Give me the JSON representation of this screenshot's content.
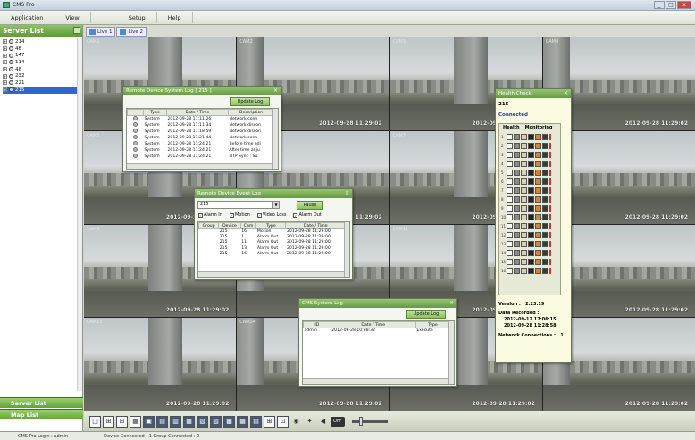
{
  "window": {
    "title": "CMS Pro",
    "min": "_",
    "max": "□",
    "close": "x"
  },
  "menu": [
    "Application",
    "View",
    "Setup",
    "Help"
  ],
  "server_list": {
    "title": "Server List",
    "items": [
      "214",
      "48",
      "147",
      "114",
      "48",
      "232",
      "221",
      "215"
    ],
    "selected_index": 7
  },
  "left_tabs": {
    "server_list": "Server List",
    "map_list": "Map List"
  },
  "view_tabs": [
    "Live 1",
    "Live 2"
  ],
  "camera_grid": {
    "timestamp": "2012-09-28 11:29:02",
    "cam_prefix": "CAM",
    "cells": 16
  },
  "system_log": {
    "title": "Remote Device System Log  [ 215 ]",
    "update_button": "Update Log",
    "columns": [
      "Type",
      "Date / Time",
      "Description"
    ],
    "rows": [
      [
        "System",
        "2012-09-28 11:11:26",
        "Network conn"
      ],
      [
        "System",
        "2012-09-28 11:11:34",
        "Network discon"
      ],
      [
        "System",
        "2012-09-28 11:18:59",
        "Network discon"
      ],
      [
        "System",
        "2012-09-28 11:21:44",
        "Network conn"
      ],
      [
        "System",
        "2012-09-28 11:24:21",
        "Before time adj"
      ],
      [
        "System",
        "2012-09-28 11:24:21",
        "After time adju"
      ],
      [
        "System",
        "2012-09-28 11:24:21",
        "NTP Sync : Su"
      ]
    ]
  },
  "event_log": {
    "title": "Remote Device Event Log",
    "device": "215",
    "pause_button": "Pause",
    "filters": [
      "Alarm In",
      "Motion",
      "Video Loss",
      "Alarm Out"
    ],
    "columns": [
      "Group",
      "Device",
      "Cam",
      "Type",
      "Date / Time"
    ],
    "rows": [
      [
        "",
        "215",
        "16",
        "Motion",
        "2012-09-28 11:29:00"
      ],
      [
        "",
        "215",
        "1",
        "Alarm Out",
        "2012-09-28 11:29:00"
      ],
      [
        "",
        "215",
        "11",
        "Alarm Out",
        "2012-09-28 11:29:00"
      ],
      [
        "",
        "215",
        "13",
        "Alarm Out",
        "2012-09-28 11:29:00"
      ],
      [
        "",
        "215",
        "16",
        "Alarm Out",
        "2012-09-28 11:29:00"
      ]
    ]
  },
  "cms_log": {
    "title": "CMS System Log",
    "update_button": "Update Log",
    "columns": [
      "ID",
      "Date / Time",
      "Type"
    ],
    "rows": [
      [
        "admin",
        "2012-09-28 10:38:32",
        "Execute"
      ]
    ]
  },
  "health": {
    "title": "Health Check",
    "device": "215",
    "status": "Connected",
    "tabs": [
      "Health",
      "Monitoring"
    ],
    "channels": [
      "1",
      "2",
      "3",
      "4",
      "5",
      "6",
      "7",
      "8",
      "9",
      "10",
      "11",
      "12",
      "13",
      "14",
      "15",
      "16"
    ],
    "version_label": "Version :",
    "version": "2.23.19",
    "recorded_label": "Data Recorded :",
    "recorded_from": "2012-09-12 17:06:15",
    "recorded_to": "2012-09-28 11:28:58",
    "connections_label": "Network Connections :",
    "connections": "1"
  },
  "toolbar": {
    "off_label": "OFF"
  },
  "status": {
    "login": "CMS Pro Login : admin",
    "connected": "Device Connected : 1   Group Connected : 0"
  }
}
